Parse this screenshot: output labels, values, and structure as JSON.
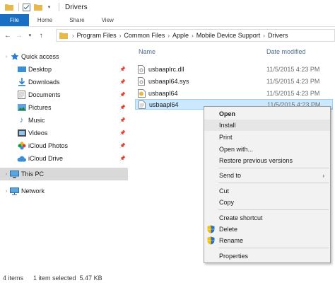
{
  "window": {
    "title": "Drivers"
  },
  "ribbon": {
    "tabs": [
      "File",
      "Home",
      "Share",
      "View"
    ]
  },
  "address": {
    "crumbs": [
      "Program Files",
      "Common Files",
      "Apple",
      "Mobile Device Support",
      "Drivers"
    ]
  },
  "nav": {
    "quick_access": "Quick access",
    "items": [
      "Desktop",
      "Downloads",
      "Documents",
      "Pictures",
      "Music",
      "Videos",
      "iCloud Photos",
      "iCloud Drive"
    ],
    "this_pc": "This PC",
    "network": "Network"
  },
  "files": {
    "col_name": "Name",
    "col_date": "Date modified",
    "rows": [
      {
        "name": "usbaaplrc.dll",
        "date": "11/5/2015 4:23 PM"
      },
      {
        "name": "usbaapl64.sys",
        "date": "11/5/2015 4:23 PM"
      },
      {
        "name": "usbaapl64",
        "date": "11/5/2015 4:23 PM"
      },
      {
        "name": "usbaapl64",
        "date": "11/5/2015 4:23 PM"
      }
    ]
  },
  "context_menu": {
    "open": "Open",
    "install": "Install",
    "print": "Print",
    "open_with": "Open with...",
    "restore": "Restore previous versions",
    "send_to": "Send to",
    "cut": "Cut",
    "copy": "Copy",
    "create_shortcut": "Create shortcut",
    "delete": "Delete",
    "rename": "Rename",
    "properties": "Properties"
  },
  "status": {
    "items": "4 items",
    "selected": "1 item selected  5.47 KB"
  },
  "colors": {
    "accent": "#1a6fc4",
    "selection": "#cce8ff",
    "folder": "#e8b84a"
  }
}
